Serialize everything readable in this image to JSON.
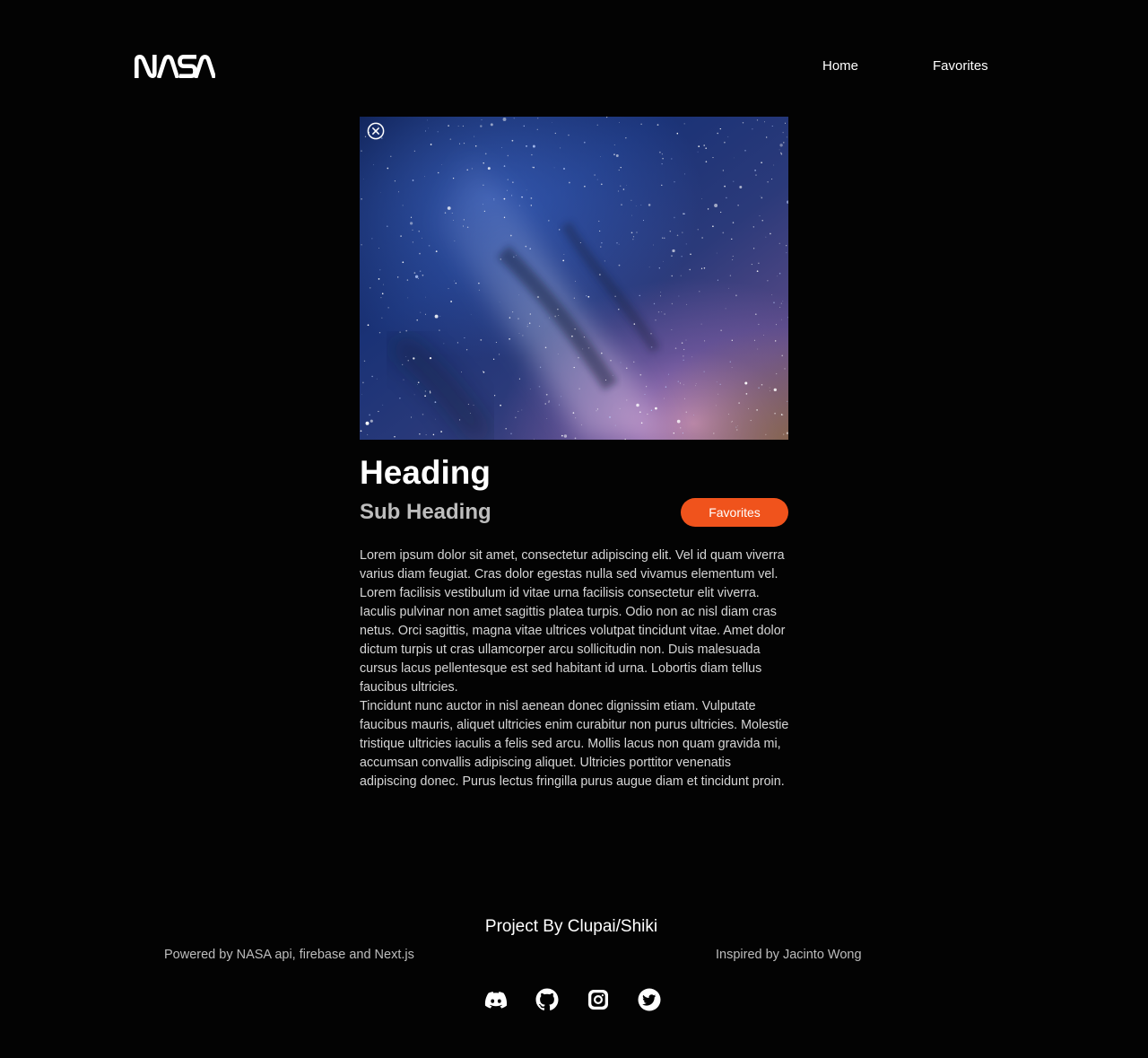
{
  "header": {
    "logo_text": "NASA",
    "nav": {
      "home_label": "Home",
      "favorites_label": "Favorites"
    }
  },
  "hero": {
    "image_icon": "starry-sky-image",
    "close_icon": "close-circle-icon"
  },
  "content": {
    "heading": "Heading",
    "subheading": "Sub Heading",
    "favorites_button_label": "Favorites",
    "paragraphs": [
      "Lorem ipsum dolor sit amet, consectetur adipiscing elit. Vel id quam viverra varius diam feugiat. Cras dolor egestas nulla sed vivamus elementum vel. Lorem facilisis vestibulum id vitae urna facilisis consectetur elit viverra. Iaculis pulvinar non amet sagittis platea turpis. Odio non ac nisl diam cras netus. Orci sagittis, magna vitae ultrices volutpat tincidunt vitae. Amet dolor dictum turpis ut cras ullamcorper arcu sollicitudin non. Duis malesuada cursus lacus pellentesque est sed habitant id urna. Lobortis diam tellus faucibus ultricies.",
      "Tincidunt nunc auctor in nisl aenean donec dignissim etiam. Vulputate faucibus mauris, aliquet ultricies enim curabitur non purus ultricies. Molestie tristique ultricies iaculis a felis sed arcu. Mollis lacus non quam gravida mi, accumsan convallis adipiscing aliquet. Ultricies porttitor venenatis adipiscing donec. Purus lectus fringilla purus augue diam et tincidunt proin."
    ]
  },
  "footer": {
    "title": "Project By Clupai/Shiki",
    "powered_by": "Powered by NASA api, firebase and Next.js",
    "inspired_by": "Inspired by Jacinto Wong",
    "social_icons": [
      "discord-icon",
      "github-icon",
      "instagram-icon",
      "twitter-icon"
    ]
  },
  "colors": {
    "background": "#030303",
    "accent": "#f0531c",
    "subheading": "#bdbdbd",
    "body_text": "#d6d6d6"
  }
}
